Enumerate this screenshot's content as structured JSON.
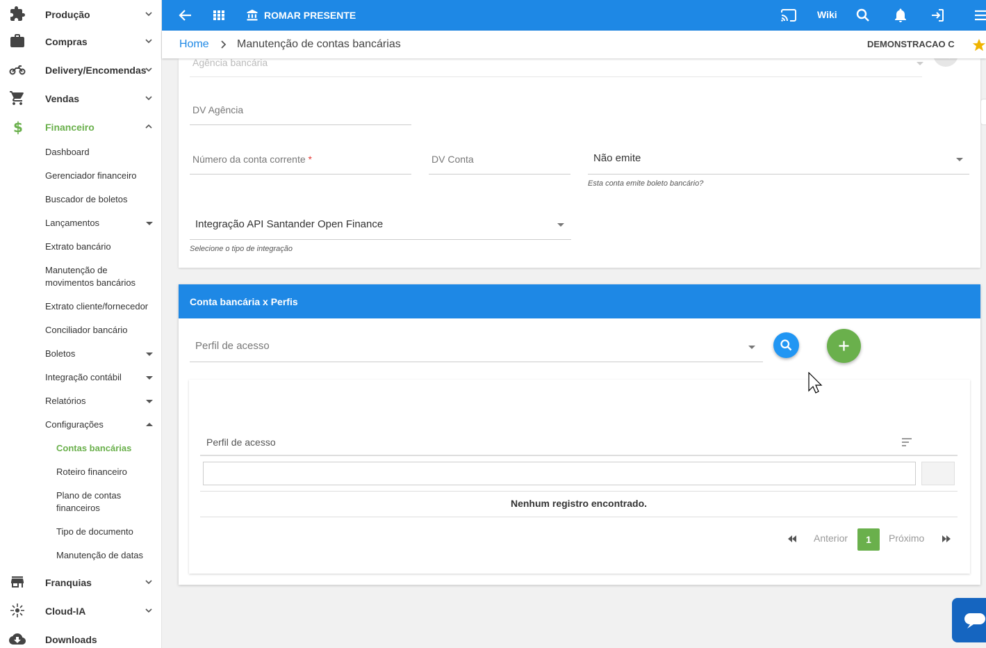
{
  "sidebar": {
    "top": [
      {
        "label": "Produção",
        "icon": "puzzle-icon"
      },
      {
        "label": "Compras",
        "icon": "briefcase-icon"
      },
      {
        "label": "Delivery/Encomendas",
        "icon": "motorcycle-icon"
      },
      {
        "label": "Vendas",
        "icon": "cart-icon"
      },
      {
        "label": "Financeiro",
        "icon": "dollar-icon"
      },
      {
        "label": "Franquias",
        "icon": "store-icon"
      },
      {
        "label": "Cloud-IA",
        "icon": "sparkle-icon"
      },
      {
        "label": "Downloads",
        "icon": "cloud-download-icon"
      }
    ],
    "financeiro_items": [
      "Dashboard",
      "Gerenciador financeiro",
      "Buscador de boletos",
      "Lançamentos",
      "Extrato bancário",
      "Manutenção de",
      "movimentos bancários",
      "Extrato cliente/fornecedor",
      "Conciliador bancário",
      "Boletos",
      "Integração contábil",
      "Relatórios",
      "Configurações"
    ],
    "config_items": [
      "Contas bancárias",
      "Roteiro financeiro",
      "Plano de contas",
      "financeiros",
      "Tipo de documento",
      "Manutenção de datas"
    ]
  },
  "topbar": {
    "company": "ROMAR PRESENTE",
    "wiki": "Wiki"
  },
  "breadcrumb": {
    "home": "Home",
    "current": "Manutenção de contas bancárias",
    "company_short": "DEMONSTRACAO C"
  },
  "form": {
    "agencia_placeholder": "Agência bancária",
    "dv_agencia": "DV Agência",
    "numero_conta": "Número da conta corrente",
    "required_mark": "*",
    "dv_conta": "DV Conta",
    "boleto_value": "Não emite",
    "boleto_hint": "Esta conta emite boleto bancário?",
    "integracao_value": "Integração API Santander Open Finance",
    "integracao_hint": "Selecione o tipo de integração"
  },
  "perfis": {
    "title": "Conta bancária x Perfis",
    "perfil_placeholder": "Perfil de acesso",
    "column_header": "Perfil de acesso",
    "empty_message": "Nenhum registro encontrado.",
    "pagination": {
      "prev": "Anterior",
      "current": "1",
      "next": "Próximo"
    }
  },
  "colors": {
    "primary": "#1e88e5",
    "accent": "#6ab04c",
    "search_button": "#2196f3"
  }
}
